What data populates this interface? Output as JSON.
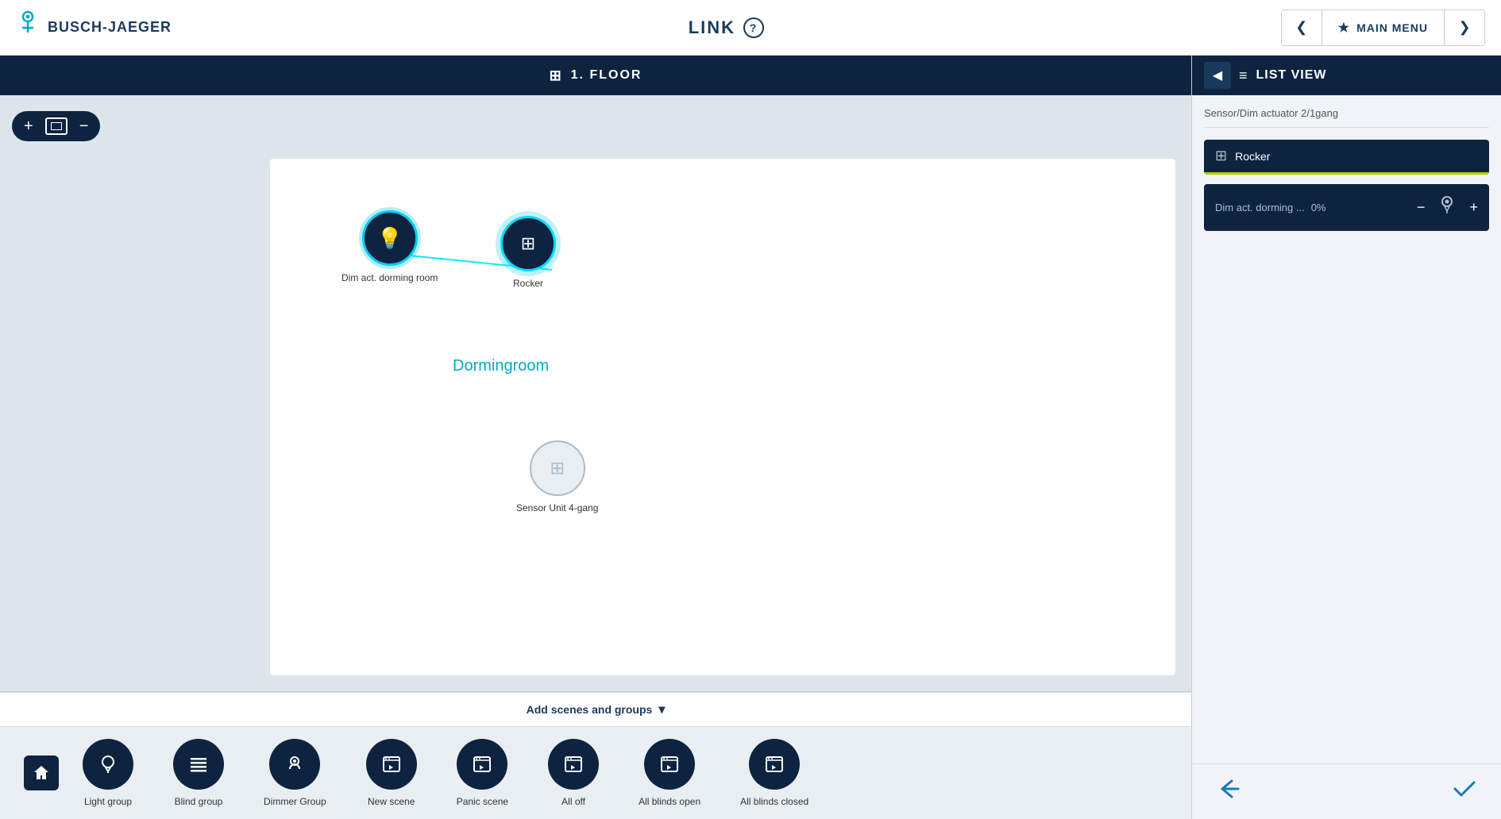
{
  "header": {
    "logo_text": "BUSCH-JAEGER",
    "center_title": "LINK",
    "help_label": "?",
    "nav_prev": "❮",
    "nav_next": "❯",
    "main_menu_label": "MAIN MENU",
    "star": "★"
  },
  "floor_header": {
    "title": "1. FLOOR",
    "icon": "⊞"
  },
  "zoom_controls": {
    "plus": "+",
    "minus": "−"
  },
  "canvas": {
    "nodes": [
      {
        "id": "dim-act",
        "label": "Dim act. dorming room",
        "type": "light",
        "active": true
      },
      {
        "id": "rocker",
        "label": "Rocker",
        "type": "rocker",
        "active": true
      },
      {
        "id": "sensor",
        "label": "Sensor Unit 4-gang",
        "type": "sensor",
        "active": false
      }
    ],
    "room_label": "Dormingroom"
  },
  "add_scenes_bar": {
    "label": "Add scenes and groups",
    "chevron": "▾"
  },
  "bottom_items": [
    {
      "id": "light-group",
      "label": "Light group",
      "icon": "💡"
    },
    {
      "id": "blind-group",
      "label": "Blind group",
      "icon": "≡"
    },
    {
      "id": "dimmer-group",
      "label": "Dimmer Group",
      "icon": "👤"
    },
    {
      "id": "new-scene",
      "label": "New scene",
      "icon": "🎬"
    },
    {
      "id": "panic-scene",
      "label": "Panic scene",
      "icon": "🎬"
    },
    {
      "id": "all-off",
      "label": "All off",
      "icon": "🎬"
    },
    {
      "id": "all-blinds-open",
      "label": "All blinds open",
      "icon": "🎬"
    },
    {
      "id": "all-blinds-closed",
      "label": "All blinds closed",
      "icon": "🎬"
    }
  ],
  "right_panel": {
    "header_title": "LIST VIEW",
    "subtitle": "Sensor/Dim actuator 2/1gang",
    "items": [
      {
        "id": "rocker-item",
        "label": "Rocker",
        "icon": "⊞",
        "has_bottom": false
      },
      {
        "id": "dim-act-item",
        "label": "Dim act. dorming ...",
        "percent": "0%",
        "icon": "💡",
        "has_controls": true
      }
    ],
    "footer_back": "↩",
    "footer_check": "✓"
  }
}
